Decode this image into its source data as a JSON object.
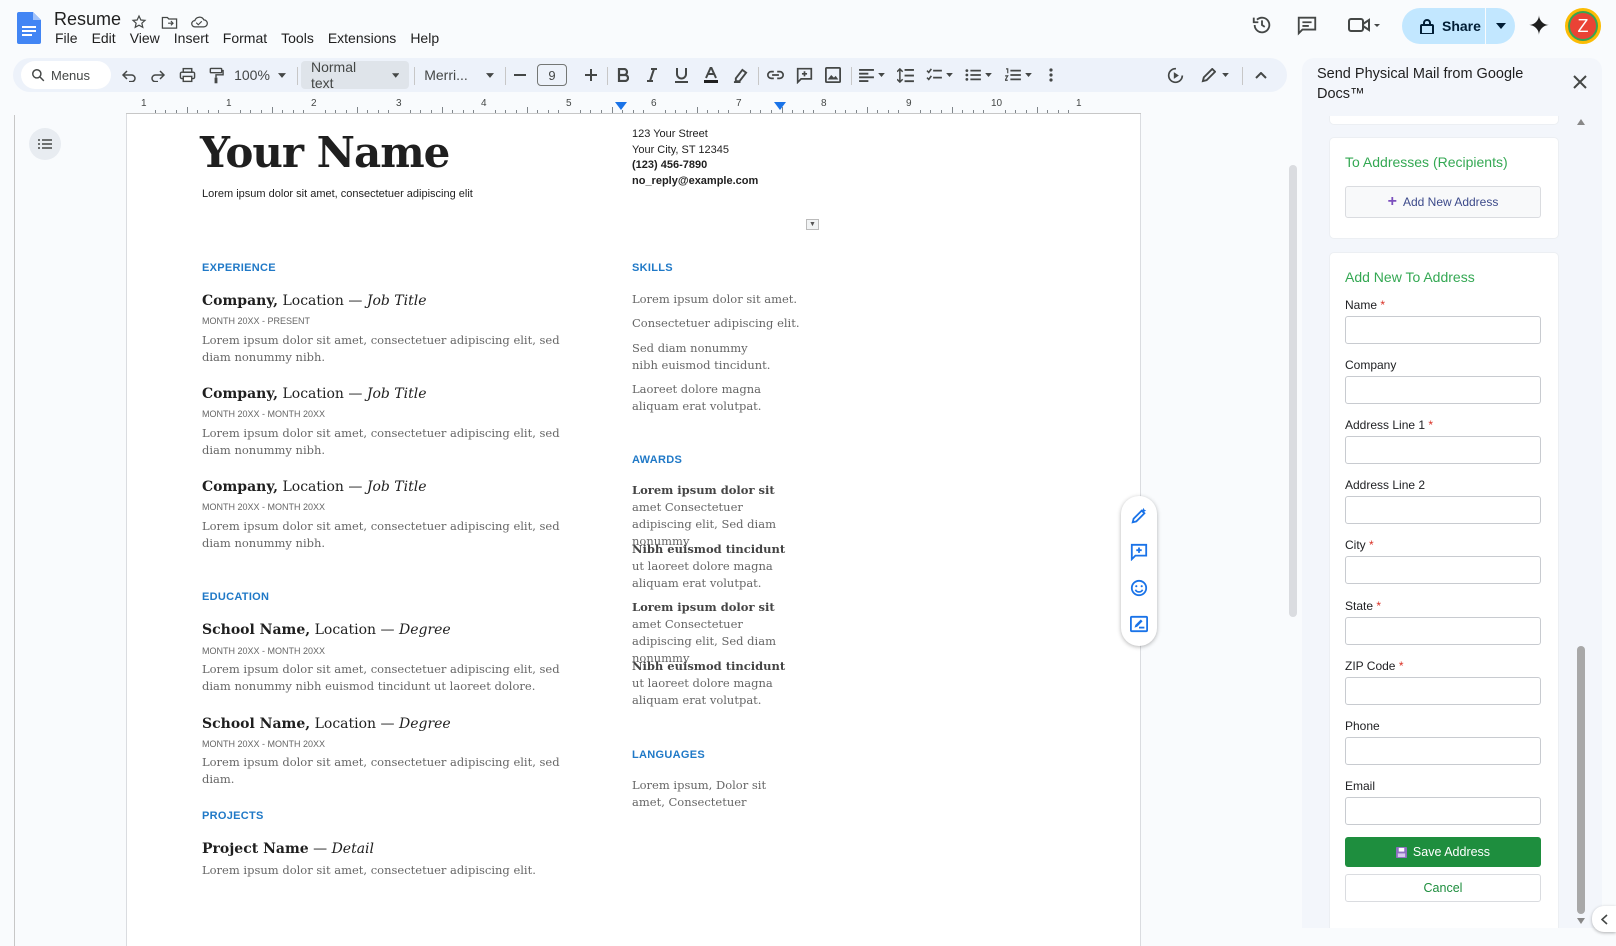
{
  "app": {
    "doc_title": "Resume",
    "menus": [
      "File",
      "Edit",
      "View",
      "Insert",
      "Format",
      "Tools",
      "Extensions",
      "Help"
    ],
    "share_label": "Share",
    "avatar_letter": "Z"
  },
  "toolbar": {
    "menus_search": "Menus",
    "zoom": "100%",
    "paragraph_style": "Normal text",
    "font": "Merri...",
    "font_size": "9"
  },
  "ruler": {
    "numbers": [
      "1",
      "1",
      "2",
      "3",
      "4",
      "5",
      "6",
      "7",
      "8",
      "9",
      "10",
      "1"
    ]
  },
  "document": {
    "name": "Your Name",
    "tagline": "Lorem ipsum dolor sit amet, consectetuer adipiscing elit",
    "contact": {
      "street": "123 Your Street",
      "city": "Your City, ST 12345",
      "phone": "(123) 456-7890",
      "email": "no_reply@example.com"
    },
    "experience_heading": "EXPERIENCE",
    "experience": [
      {
        "company": "Company,",
        "location": " Location — ",
        "title": "Job Title",
        "dates": "MONTH 20XX - PRESENT",
        "text": "Lorem ipsum dolor sit amet, consectetuer adipiscing elit, sed diam nonummy nibh."
      },
      {
        "company": "Company,",
        "location": " Location — ",
        "title": "Job Title",
        "dates": "MONTH 20XX - MONTH 20XX",
        "text": "Lorem ipsum dolor sit amet, consectetuer adipiscing elit, sed diam nonummy nibh."
      },
      {
        "company": "Company,",
        "location": " Location — ",
        "title": "Job Title",
        "dates": "MONTH 20XX - MONTH 20XX",
        "text": "Lorem ipsum dolor sit amet, consectetuer adipiscing elit, sed diam nonummy nibh."
      }
    ],
    "education_heading": "EDUCATION",
    "education": [
      {
        "school": "School Name,",
        "location": " Location — ",
        "degree": "Degree",
        "dates": "MONTH 20XX - MONTH 20XX",
        "text": "Lorem ipsum dolor sit amet, consectetuer adipiscing elit, sed diam nonummy nibh euismod tincidunt ut laoreet dolore."
      },
      {
        "school": "School Name,",
        "location": " Location — ",
        "degree": "Degree",
        "dates": "MONTH 20XX - MONTH 20XX",
        "text": "Lorem ipsum dolor sit amet, consectetuer adipiscing elit, sed diam."
      }
    ],
    "projects_heading": "PROJECTS",
    "project": {
      "name": "Project Name",
      "sep": " — ",
      "detail": "Detail",
      "text": "Lorem ipsum dolor sit amet, consectetuer adipiscing elit."
    },
    "skills_heading": "SKILLS",
    "skills": [
      "Lorem ipsum dolor sit amet.",
      "Consectetuer adipiscing elit.",
      "Sed diam nonummy nibh euismod tincidunt.",
      "Laoreet dolore magna aliquam erat volutpat."
    ],
    "awards_heading": "AWARDS",
    "awards": [
      {
        "bold": "Lorem ipsum dolor sit",
        "rest": " amet Consectetuer adipiscing elit, Sed diam nonummy"
      },
      {
        "bold": "Nibh euismod tincidunt",
        "rest": " ut laoreet dolore magna aliquam erat volutpat."
      },
      {
        "bold": "Lorem ipsum dolor sit",
        "rest": " amet Consectetuer adipiscing elit, Sed diam nonummy"
      },
      {
        "bold": "Nibh euismod tincidunt",
        "rest": " ut laoreet dolore magna aliquam erat volutpat."
      }
    ],
    "languages_heading": "LANGUAGES",
    "languages": "Lorem ipsum, Dolor sit amet, Consectetuer"
  },
  "panel": {
    "title": "Send Physical Mail from Google Docs™",
    "to_heading": "To Addresses (Recipients)",
    "add_new_label": "Add New Address",
    "form_heading": "Add New To Address",
    "fields": [
      {
        "label": "Name",
        "required": "*",
        "value": ""
      },
      {
        "label": "Company",
        "required": "",
        "value": ""
      },
      {
        "label": "Address Line 1",
        "required": "*",
        "value": ""
      },
      {
        "label": "Address Line 2",
        "required": "",
        "value": ""
      },
      {
        "label": "City",
        "required": "*",
        "value": ""
      },
      {
        "label": "State",
        "required": "*",
        "value": ""
      },
      {
        "label": "ZIP Code",
        "required": "*",
        "value": ""
      },
      {
        "label": "Phone",
        "required": "",
        "value": ""
      },
      {
        "label": "Email",
        "required": "",
        "value": ""
      }
    ],
    "save_label": "Save Address",
    "cancel_label": "Cancel"
  },
  "colors": {
    "accent_blue": "#2079c7",
    "panel_green": "#34a853",
    "save_green": "#1e8e3e",
    "share_bg": "#c2e7ff"
  }
}
